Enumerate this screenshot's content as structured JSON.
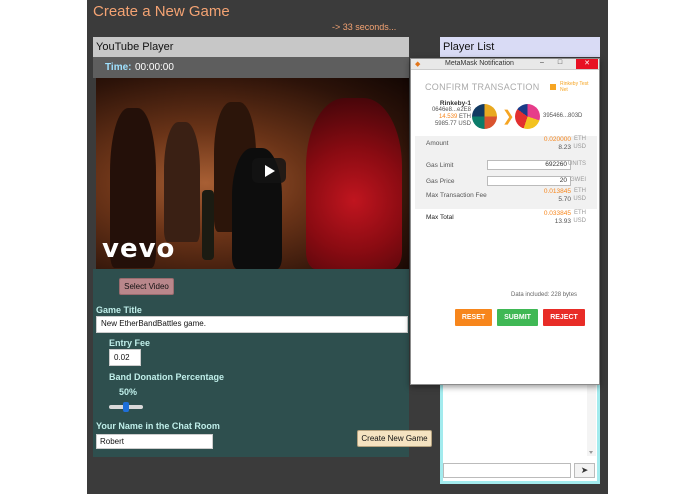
{
  "page": {
    "title": "Create a New Game",
    "countdown": "-> 33 seconds..."
  },
  "youtube": {
    "header": "YouTube Player",
    "time_label": "Time:",
    "time_value": "00:00:00",
    "watermark": "vevo"
  },
  "form": {
    "select_video_label": "Select Video",
    "game_title_label": "Game Title",
    "game_title_value": "New EtherBandBattles game.",
    "entry_fee_label": "Entry Fee",
    "entry_fee_value": "0.02",
    "donation_label": "Band Donation Percentage",
    "donation_value": "50%",
    "donation_level": 0.5,
    "name_label": "Your Name in the Chat Room",
    "name_value": "Robert",
    "create_button": "Create New Game"
  },
  "player_list": {
    "header": "Player List",
    "send_icon": "paper-plane-icon"
  },
  "metamask": {
    "window_title": "MetaMask Notification",
    "window_controls": {
      "minimize": "–",
      "maximize": "□",
      "close": "✕"
    },
    "heading": "CONFIRM TRANSACTION",
    "network": "Rinkeby Test Net",
    "from": {
      "name": "Rinkeby-1",
      "address": "0646e8...e2E8",
      "eth": "14.539",
      "eth_unit": "ETH",
      "usd": "5985.77",
      "usd_unit": "USD"
    },
    "to_address": "395466...803D",
    "rows": {
      "amount": {
        "label": "Amount",
        "eth": "0.020000",
        "eth_unit": "ETH",
        "usd": "8.23",
        "usd_unit": "USD"
      },
      "gas_limit": {
        "label": "Gas Limit",
        "value": "692260",
        "unit": "UNITS"
      },
      "gas_price": {
        "label": "Gas Price",
        "value": "20",
        "unit": "GWEI"
      },
      "max_fee": {
        "label": "Max Transaction Fee",
        "eth": "0.013845",
        "eth_unit": "ETH",
        "usd": "5.70",
        "usd_unit": "USD"
      },
      "max_total": {
        "label": "Max Total",
        "eth": "0.033845",
        "eth_unit": "ETH",
        "usd": "13.93",
        "usd_unit": "USD"
      }
    },
    "data_included": "Data included: 228 bytes",
    "buttons": {
      "reset": "RESET",
      "submit": "SUBMIT",
      "reject": "REJECT"
    }
  },
  "colors": {
    "accent_orange": "#f4a373",
    "form_panel": "#2e4f4e",
    "label_cyan": "#bfeee9",
    "metamask_orange": "#f7861c",
    "submit_green": "#3fb855",
    "reject_red": "#e82c27"
  }
}
